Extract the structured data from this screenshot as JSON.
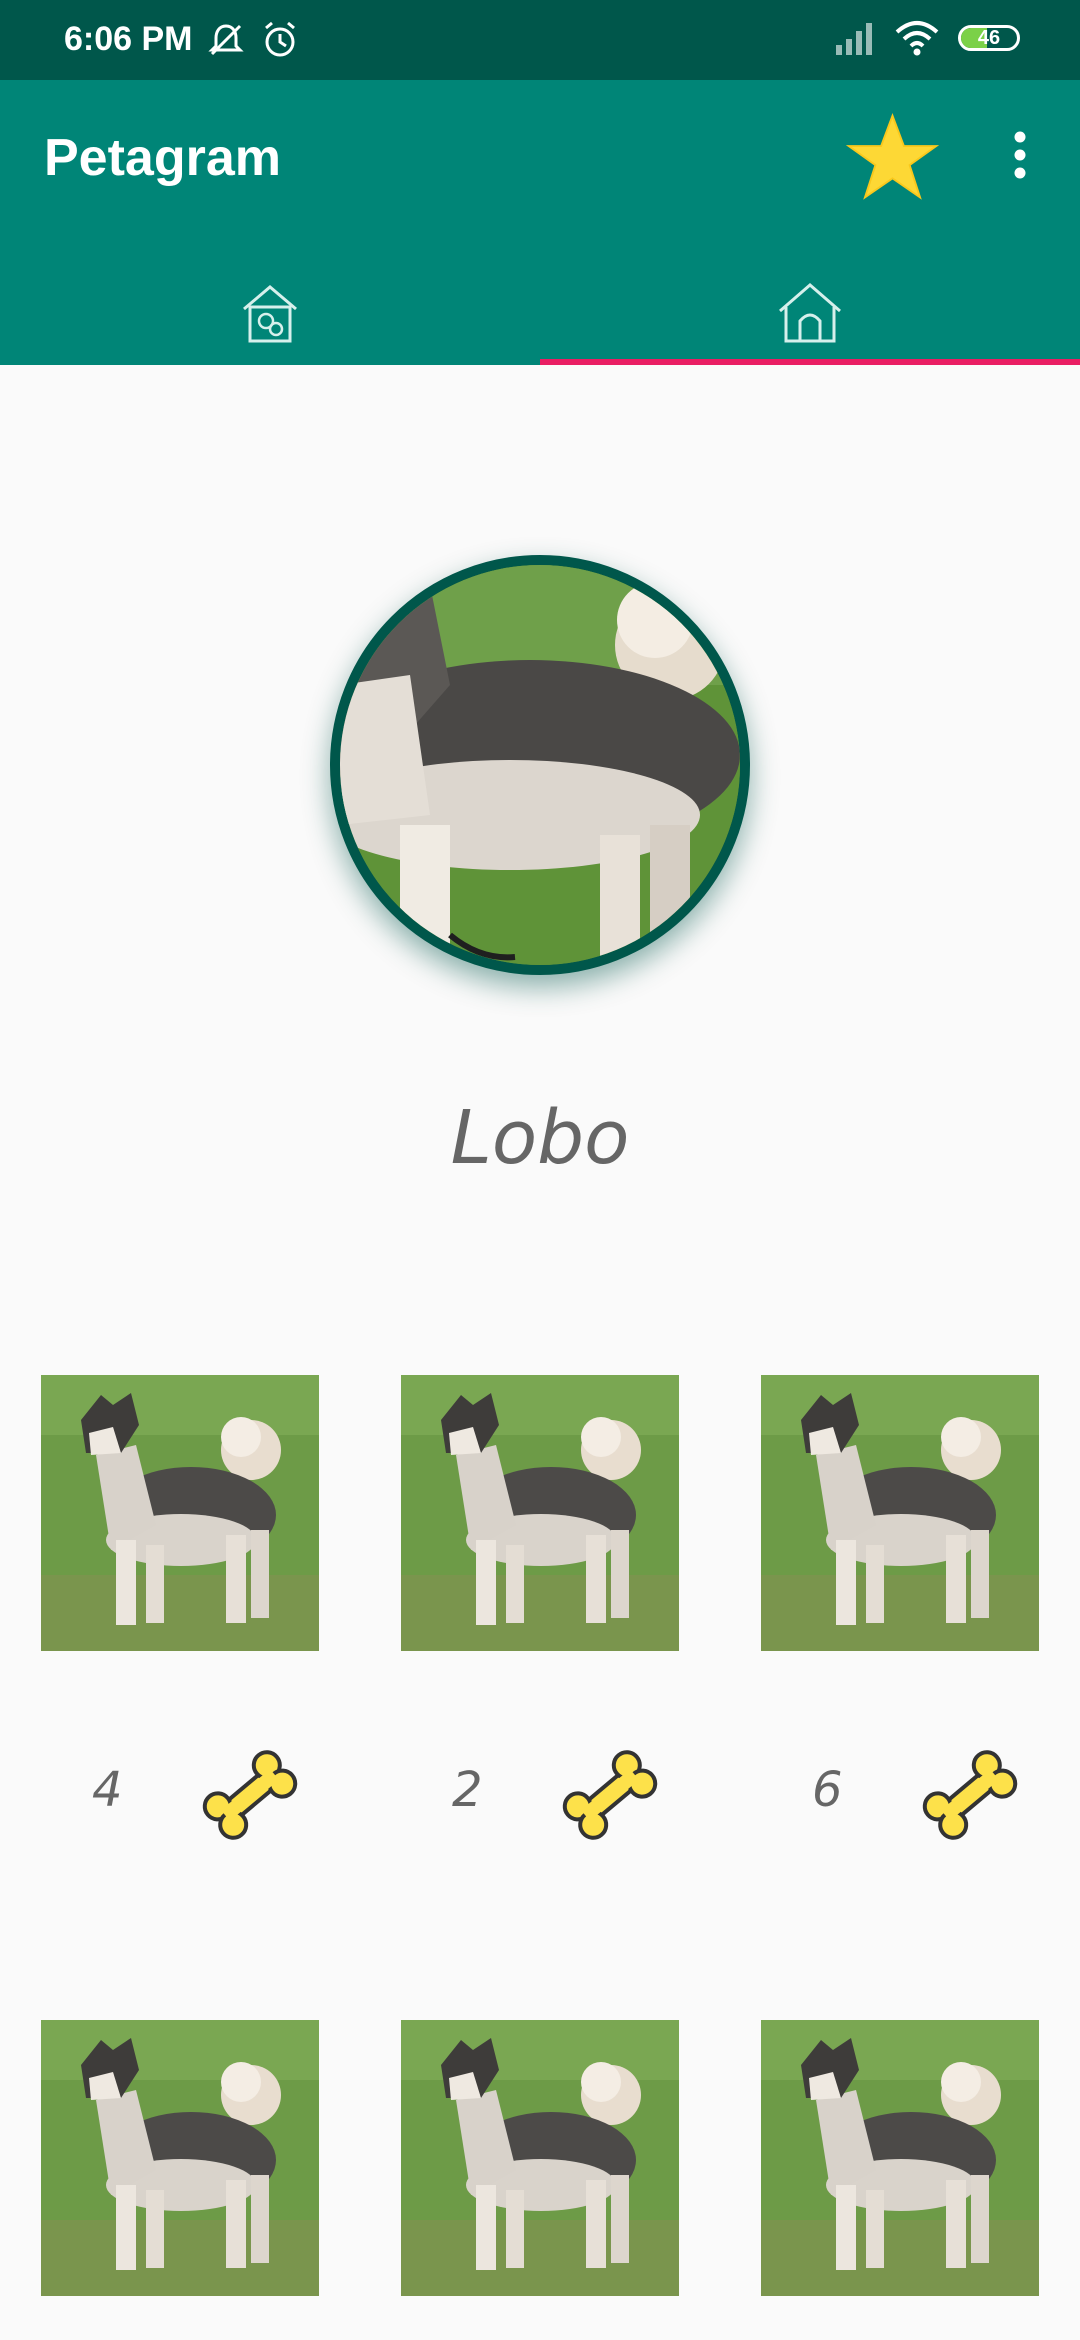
{
  "status_bar": {
    "time": "6:06 PM",
    "battery_level": "46",
    "icons": [
      "notifications-off-icon",
      "alarm-icon",
      "signal-icon",
      "wifi-icon",
      "battery-icon"
    ]
  },
  "app_bar": {
    "title": "Petagram",
    "actions": [
      "star-icon",
      "more-vertical-icon"
    ]
  },
  "tabs": [
    {
      "icon": "pet-house-icon",
      "selected": false
    },
    {
      "icon": "home-icon",
      "selected": true
    }
  ],
  "profile": {
    "name": "Lobo",
    "photo": "dog-photo"
  },
  "gallery": {
    "items": [
      {
        "likes": "4",
        "like_icon": "bone-icon"
      },
      {
        "likes": "2",
        "like_icon": "bone-icon"
      },
      {
        "likes": "6",
        "like_icon": "bone-icon"
      },
      {
        "likes": "",
        "like_icon": ""
      },
      {
        "likes": "",
        "like_icon": ""
      },
      {
        "likes": "",
        "like_icon": ""
      }
    ]
  },
  "colors": {
    "primary": "#008577",
    "primary_dark": "#00574b",
    "accent": "#e91e63",
    "star": "#fdd835",
    "bone": "#fde14a"
  }
}
